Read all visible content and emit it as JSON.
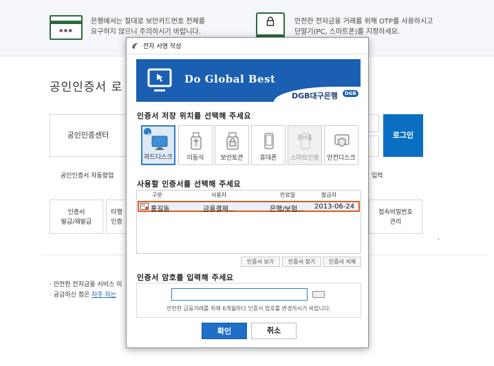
{
  "notices": {
    "left_card_stars": "***",
    "left_line1": "은행에서는 절대로 보안카드번호 전체를",
    "left_line2": "요구하지 않으니 주의하시기 바랍니다.",
    "right_line1": "안전한 전자금융 거래를 위해 OTP를 사용하시고",
    "right_line2": "단말기(PC, 스마트폰)를 지정하세요."
  },
  "background": {
    "title": "공인인증서 로",
    "cert_center": "공인인증센터",
    "login": "로그인",
    "auto_popup": "공인인증서 자동팝업",
    "input_suffix": "입력",
    "issue_line1": "인증서",
    "issue_line2": "발급/재발급",
    "other_line1": "타행",
    "other_line2": "인증",
    "pw_line1": "접속비밀번호",
    "pw_line2": "관리",
    "bullet1": "· 안전한 전자금융 서비스 이",
    "bullet2_prefix": "· 궁금하신 점은 ",
    "bullet2_link": "자주 하는 "
  },
  "dialog": {
    "title": "전자 서명 작성",
    "banner": {
      "slogan": "Do Global Best",
      "bank": "DGB대구은행",
      "bank_badge": "DGB"
    },
    "storage_title": "인증서 저장 위치를 선택해 주세요",
    "storage": [
      {
        "label": "하드디스크",
        "icon": "hard-disk-icon",
        "selected": true,
        "disabled": false
      },
      {
        "label": "이동식",
        "icon": "usb-icon",
        "selected": false,
        "disabled": false
      },
      {
        "label": "보안토큰",
        "icon": "security-token-icon",
        "selected": false,
        "disabled": false
      },
      {
        "label": "휴대폰",
        "icon": "phone-icon",
        "selected": false,
        "disabled": false
      },
      {
        "label": "스마트인증",
        "icon": "smart-auth-icon",
        "selected": false,
        "disabled": true,
        "badge": "준비중"
      },
      {
        "label": "안전디스크",
        "icon": "safe-disk-icon",
        "selected": false,
        "disabled": false
      }
    ],
    "cert_title": "사용할 인증서를 선택해 주세요",
    "columns": [
      "구분",
      "사용자",
      "만료일",
      "발급자"
    ],
    "certs": [
      {
        "user": "홍길동",
        "type": "금융결제...",
        "issuer": "은행/보험...",
        "expiry": "2013-06-24"
      }
    ],
    "buttons": {
      "view": "인증서 보기",
      "find": "인증서 찾기",
      "delete": "인증서 삭제",
      "ok": "확인",
      "cancel": "취소"
    },
    "password_title": "인증서 암호를 입력해 주세요",
    "password_value": "",
    "password_note": "안전한 금융거래를 위해 6개월마다 인증서 암호를 변경하시기 바랍니다."
  },
  "colors": {
    "accent": "#1f6fc6",
    "banner": "#1a5fb1",
    "selection_border": "#e05a1a",
    "notice_icon": "#2a6a3a"
  }
}
